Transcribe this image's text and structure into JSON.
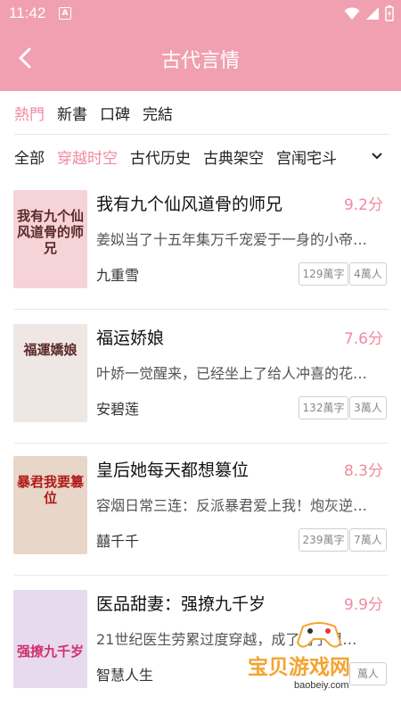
{
  "status": {
    "time": "11:42",
    "notification_icon": "A"
  },
  "header": {
    "title": "古代言情"
  },
  "filters": {
    "sort": [
      {
        "label": "熱門",
        "active": true
      },
      {
        "label": "新書",
        "active": false
      },
      {
        "label": "口碑",
        "active": false
      },
      {
        "label": "完結",
        "active": false
      }
    ],
    "categories": [
      {
        "label": "全部",
        "active": false
      },
      {
        "label": "穿越时空",
        "active": true
      },
      {
        "label": "古代历史",
        "active": false
      },
      {
        "label": "古典架空",
        "active": false
      },
      {
        "label": "宫闱宅斗",
        "active": false
      }
    ]
  },
  "books": [
    {
      "title": "我有九个仙风道骨的师兄",
      "score": "9.2分",
      "desc": "姜姒当了十五年集万千宠爱于一身的小帝…",
      "author": "九重雪",
      "words": "129萬字",
      "readers": "4萬人",
      "cover_text": "我有九个仙风道骨的师兄",
      "cover_color": "#f6d3d6"
    },
    {
      "title": "福运娇娘",
      "score": "7.6分",
      "desc": "叶娇一觉醒来，已经坐上了给人冲喜的花…",
      "author": "安碧莲",
      "words": "132萬字",
      "readers": "3萬人",
      "cover_text": "福運嬌娘",
      "cover_color": "#efe7e3"
    },
    {
      "title": "皇后她每天都想篡位",
      "score": "8.3分",
      "desc": "容烟日常三连：反派暴君爱上我！炮灰逆…",
      "author": "囍千千",
      "words": "239萬字",
      "readers": "7萬人",
      "cover_text": "暴君我要篡位",
      "cover_color": "#e8d6c8"
    },
    {
      "title": "医品甜妻：强撩九千岁",
      "score": "9.9分",
      "desc": "21世纪医生劳累过度穿越，成了村子里…",
      "author": "智慧人生",
      "words": "",
      "readers": "萬人",
      "cover_text": "强撩九千岁",
      "cover_color": "#e7d9ee"
    }
  ],
  "watermark": {
    "text": "宝贝游戏网",
    "url": "baobeiy.com"
  },
  "colors": {
    "accent": "#f0a0b0",
    "active_text": "#f08aa0"
  }
}
